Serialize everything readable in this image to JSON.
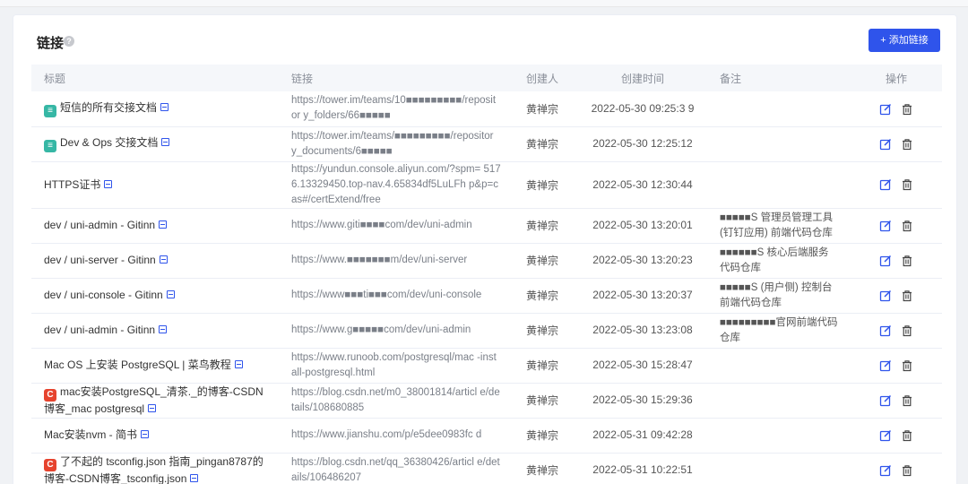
{
  "card": {
    "title": "链接",
    "add_button": "+ 添加链接"
  },
  "table": {
    "headers": [
      "标题",
      "链接",
      "创建人",
      "创建时间",
      "备注",
      "操作"
    ],
    "rows": [
      {
        "icon": "tower",
        "title": "短信的所有交接文档",
        "link": "https://tower.im/teams/10■■■■■■■■■/repositor y_folders/66■■■■■",
        "user": "黄禅宗",
        "time": "2022-05-30 09:25:3 9",
        "note": ""
      },
      {
        "icon": "tower",
        "title": "Dev & Ops 交接文档",
        "link": "https://tower.im/teams/■■■■■■■■■/repositor y_documents/6■■■■■",
        "user": "黄禅宗",
        "time": "2022-05-30 12:25:12",
        "note": ""
      },
      {
        "icon": "",
        "title": "HTTPS证书",
        "link": "https://yundun.console.aliyun.com/?spm= 5176.13329450.top-nav.4.65834df5LuLFh p&p=cas#/certExtend/free",
        "user": "黄禅宗",
        "time": "2022-05-30 12:30:44",
        "note": ""
      },
      {
        "icon": "",
        "title": "dev / uni-admin - Gitinn",
        "link": "https://www.giti■■■■com/dev/uni-admin",
        "user": "黄禅宗",
        "time": "2022-05-30 13:20:01",
        "note": "■■■■■S 管理员管理工具 (钉钉应用) 前端代码仓库"
      },
      {
        "icon": "",
        "title": "dev / uni-server - Gitinn",
        "link": "https://www.■■■■■■■m/dev/uni-server",
        "user": "黄禅宗",
        "time": "2022-05-30 13:20:23",
        "note": "■■■■■■S 核心后端服务代码仓库"
      },
      {
        "icon": "",
        "title": "dev / uni-console - Gitinn",
        "link": "https://www■■■ti■■■com/dev/uni-console",
        "user": "黄禅宗",
        "time": "2022-05-30 13:20:37",
        "note": "■■■■■S (用户侧) 控制台前端代码仓库"
      },
      {
        "icon": "",
        "title": "dev / uni-admin - Gitinn",
        "link": "https://www.g■■■■■com/dev/uni-admin",
        "user": "黄禅宗",
        "time": "2022-05-30 13:23:08",
        "note": "■■■■■■■■■官网前端代码仓库"
      },
      {
        "icon": "",
        "title": "Mac OS 上安装 PostgreSQL | 菜鸟教程",
        "link": "https://www.runoob.com/postgresql/mac -install-postgresql.html",
        "user": "黄禅宗",
        "time": "2022-05-30 15:28:47",
        "note": ""
      },
      {
        "icon": "csdn",
        "title": "mac安装PostgreSQL_清茶._的博客-CSDN博客_mac postgresql",
        "link": "https://blog.csdn.net/m0_38001814/articl e/details/108680885",
        "user": "黄禅宗",
        "time": "2022-05-30 15:29:36",
        "note": ""
      },
      {
        "icon": "",
        "title": "Mac安装nvm - 简书",
        "link": "https://www.jianshu.com/p/e5dee0983fc d",
        "user": "黄禅宗",
        "time": "2022-05-31 09:42:28",
        "note": ""
      },
      {
        "icon": "csdn",
        "title": "了不起的 tsconfig.json 指南_pingan8787的博客-CSDN博客_tsconfig.json",
        "link": "https://blog.csdn.net/qq_36380426/articl e/details/106486207",
        "user": "黄禅宗",
        "time": "2022-05-31 10:22:51",
        "note": ""
      }
    ]
  },
  "colors": {
    "primary": "#2f54eb",
    "header_bg": "#f5f7fa"
  },
  "icons": {
    "edit": "edit-icon",
    "delete": "delete-icon",
    "help": "question-circle-icon",
    "external": "external-link-icon"
  }
}
